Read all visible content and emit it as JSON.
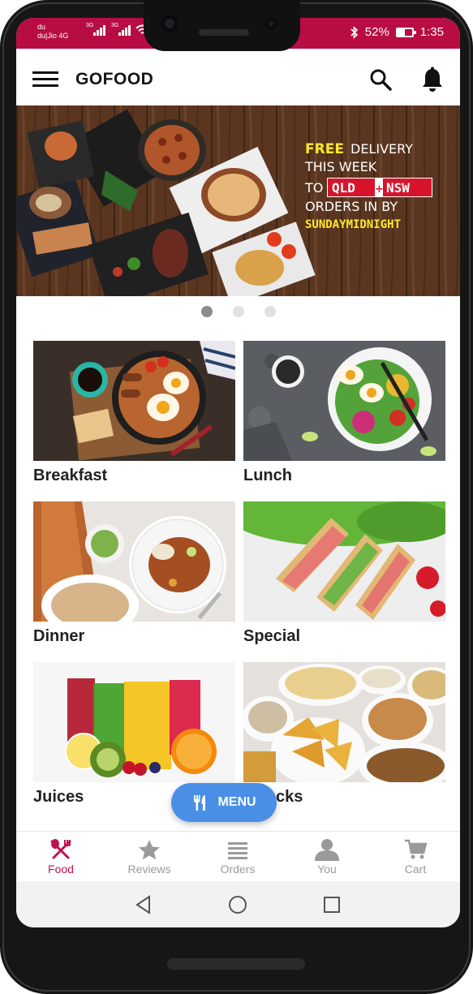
{
  "status_bar": {
    "operator_line1": "du",
    "operator_line2": "du|Jio 4G",
    "sig1_tag": "3G",
    "sig2_tag": "3G",
    "battery": "52%",
    "battery_level": 0.52,
    "time": "1:35",
    "bg_color": "#b80d42"
  },
  "app_bar": {
    "title": "GOFOOD",
    "icons": [
      "menu-icon",
      "search-icon",
      "bell-icon"
    ]
  },
  "banner": {
    "line1_highlight": "FREE",
    "line1_rest": " DELIVERY",
    "line2": "THIS WEEK",
    "line3_prefix": "TO ",
    "state1": "QLD",
    "plus": "+",
    "state2": "NSW",
    "line4": "ORDERS IN BY",
    "line5": "SUNDAYMIDNIGHT",
    "accent_color": "#ffe92a",
    "box_color": "#d7142c",
    "pages": 3,
    "active_page": 1
  },
  "categories": [
    {
      "label": "Breakfast"
    },
    {
      "label": "Lunch"
    },
    {
      "label": "Dinner"
    },
    {
      "label": "Special"
    },
    {
      "label": "Juices"
    },
    {
      "label": "cks"
    }
  ],
  "menu_button": {
    "label": "MENU",
    "icon": "fork-knife-icon",
    "color": "#4a8fe6"
  },
  "bottom_nav": {
    "active_color": "#c0124a",
    "items": [
      {
        "label": "Food",
        "icon": "food-icon",
        "active": true
      },
      {
        "label": "Reviews",
        "icon": "star-icon",
        "active": false
      },
      {
        "label": "Orders",
        "icon": "list-icon",
        "active": false
      },
      {
        "label": "You",
        "icon": "user-icon",
        "active": false
      },
      {
        "label": "Cart",
        "icon": "cart-icon",
        "active": false
      }
    ]
  },
  "system_nav": [
    "back-icon",
    "home-icon",
    "recents-icon"
  ]
}
